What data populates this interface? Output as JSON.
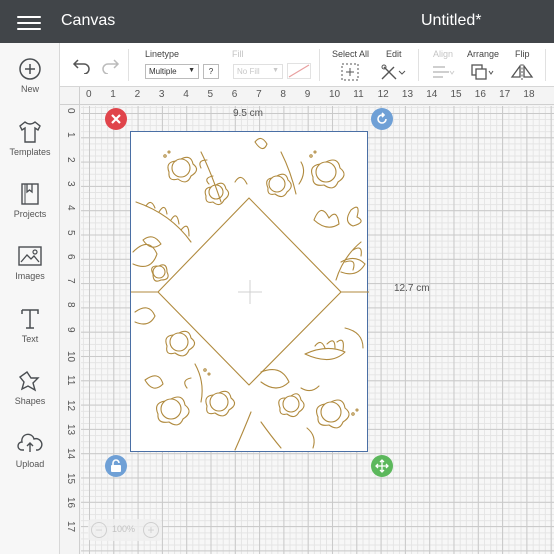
{
  "header": {
    "app_title": "Canvas",
    "doc_title": "Untitled*"
  },
  "sidebar": {
    "items": [
      {
        "label": "New",
        "icon": "plus-circle-icon"
      },
      {
        "label": "Templates",
        "icon": "tshirt-icon"
      },
      {
        "label": "Projects",
        "icon": "bookmark-book-icon"
      },
      {
        "label": "Images",
        "icon": "image-icon"
      },
      {
        "label": "Text",
        "icon": "text-t-icon"
      },
      {
        "label": "Shapes",
        "icon": "shapes-icon"
      },
      {
        "label": "Upload",
        "icon": "cloud-upload-icon"
      }
    ]
  },
  "toolbar": {
    "linetype_label": "Linetype",
    "linetype_value": "Multiple",
    "fill_label": "Fill",
    "fill_value": "No Fill",
    "select_all_label": "Select All",
    "edit_label": "Edit",
    "align_label": "Align",
    "arrange_label": "Arrange",
    "flip_label": "Flip"
  },
  "ruler": {
    "top": [
      "0",
      "1",
      "2",
      "3",
      "4",
      "5",
      "6",
      "7",
      "8",
      "9",
      "10",
      "11",
      "12",
      "13",
      "14",
      "15",
      "16",
      "17",
      "18"
    ],
    "left": [
      "0",
      "1",
      "2",
      "3",
      "4",
      "5",
      "6",
      "7",
      "8",
      "9",
      "10",
      "11",
      "12",
      "13",
      "14",
      "15",
      "16",
      "17"
    ]
  },
  "selection": {
    "width_label": "9.5 cm",
    "height_label": "12.7 cm",
    "line_color": "#b08a3e",
    "border_color": "#4a6fa5"
  },
  "zoom": {
    "value": "100%"
  },
  "colors": {
    "topbar": "#414549",
    "delete_handle": "#e0444b",
    "rotate_handle": "#6fa0d6",
    "lock_handle": "#6fa0d6",
    "scale_handle": "#5cb85c"
  }
}
